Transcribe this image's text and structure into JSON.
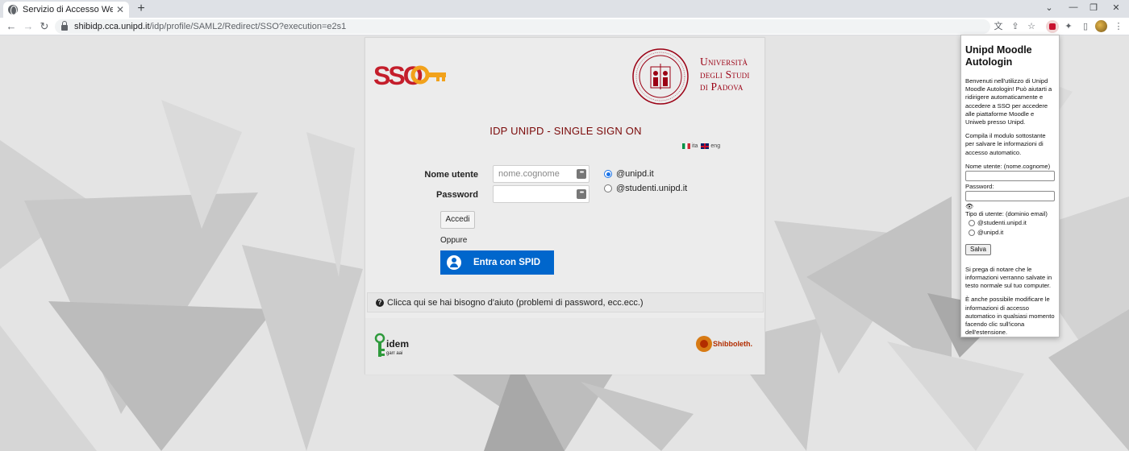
{
  "browser": {
    "tab_title": "Servizio di Accesso Web - idp",
    "tab_close": "✕",
    "new_tab": "+",
    "win_min": "⌄",
    "win_minimize": "—",
    "win_restore": "❐",
    "win_close": "✕",
    "url_host": "shibidp.cca.unipd.it",
    "url_path": "/idp/profile/SAML2/Redirect/SSO?execution=e2s1",
    "back": "←",
    "forward": "→",
    "reload": "↻",
    "translate": "文",
    "share": "⇪",
    "star": "☆",
    "puzzle": "✦",
    "sidepanel": "▯",
    "menu": "⋮"
  },
  "sso": {
    "logo_text": "SSO",
    "university_line1": "Università",
    "university_line2": "degli Studi",
    "university_line3": "di Padova",
    "title": "IDP UNIPD - SINGLE SIGN ON",
    "lang_it": "ita",
    "lang_en": "eng",
    "username_label": "Nome utente",
    "username_placeholder": "nome.cognome",
    "password_label": "Password",
    "domain_options": [
      "@unipd.it",
      "@studenti.unipd.it"
    ],
    "domain_selected": "@unipd.it",
    "login_button": "Accedi",
    "or_text": "Oppure",
    "spid_button": "Entra con SPID",
    "help_text": "Clicca qui se hai bisogno d'aiuto (problemi di password, ecc.ecc.)",
    "idem_text": "idem",
    "idem_sub": "garr aai",
    "shibboleth_text": "Shibboleth."
  },
  "popup": {
    "title": "Unipd Moodle Autologin",
    "intro": "Benvenuti nell'utilizzo di Unipd Moodle Autologin! Può aiutarti a ridirigere automaticamente e accedere a SSO per accedere alle piattaforme Moodle e Uniweb presso Unipd.",
    "instruction": "Compila il modulo sottostante per salvare le informazioni di accesso automatico.",
    "username_label": "Nome utente: (nome.cognome)",
    "password_label": "Password:",
    "show_password": "👁",
    "type_label": "Tipo di utente: (dominio email)",
    "type_options": [
      "@studenti.unipd.it",
      "@unipd.it"
    ],
    "save_button": "Salva",
    "note1": "Si prega di notare che le informazioni verranno salvate in testo normale sul tuo computer.",
    "note2": "È anche possibile modificare le informazioni di accesso automatico in qualsiasi momento facendo clic sull'icona dell'estensione."
  },
  "colors": {
    "unipd_red": "#9b0014",
    "spid_blue": "#0066cc",
    "title_red": "#7b0a0a",
    "page_bg": "#e4e4e4"
  }
}
